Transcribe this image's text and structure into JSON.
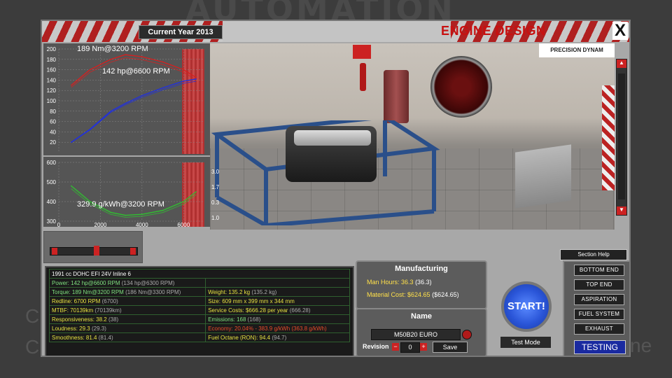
{
  "background": {
    "logo_text": "AUTOMATION",
    "left_letters": [
      "C",
      "C"
    ],
    "right_text": "ne"
  },
  "titlebar": {
    "year": "Current Year 2013",
    "title": "ENGINE DESIGN",
    "close": "X"
  },
  "viewport": {
    "dyno_brand": "PRECISION DYNAM"
  },
  "chart_data": [
    {
      "type": "line",
      "title": "",
      "y_ticks": [
        200,
        180,
        160,
        140,
        120,
        100,
        80,
        60,
        40,
        20
      ],
      "ylim": [
        0,
        200
      ],
      "annotations": [
        "189 Nm@3200 RPM",
        "142 hp@6600 RPM"
      ],
      "series": [
        {
          "color": "#d42020",
          "x": [
            600,
            1500,
            2500,
            3200,
            4000,
            5000,
            6000,
            6600
          ],
          "values": [
            130,
            160,
            180,
            189,
            185,
            175,
            160,
            145
          ]
        },
        {
          "color": "#2030e0",
          "x": [
            600,
            1500,
            2500,
            3200,
            4000,
            5000,
            6000,
            6600
          ],
          "values": [
            20,
            45,
            80,
            95,
            110,
            125,
            138,
            142
          ]
        }
      ]
    },
    {
      "type": "line",
      "title": "",
      "y_ticks": [
        600,
        500,
        400,
        300
      ],
      "x_ticks": [
        0,
        2000,
        4000,
        6000
      ],
      "ylim": [
        300,
        600
      ],
      "annotations": [
        "329.9 g/kWh@3200 RPM"
      ],
      "series": [
        {
          "color": "#30c030",
          "x": [
            600,
            1500,
            2500,
            3200,
            4000,
            5000,
            6000,
            6600
          ],
          "values": [
            480,
            400,
            345,
            330,
            335,
            355,
            400,
            450
          ]
        }
      ]
    }
  ],
  "right_axis_ticks": [
    "3.0",
    "1.7",
    "0.3",
    "1.0"
  ],
  "section_help": "Section Help",
  "stats": {
    "header": "1991 cc DOHC EFI 24V Inline 6",
    "rows": [
      {
        "left": "Power: 142 hp@6600 RPM",
        "left_paren": "(134 hp@6300 RPM)",
        "right": "",
        "right_paren": ""
      },
      {
        "left": "Torque: 189 Nm@3200 RPM",
        "left_paren": "(186 Nm@3300 RPM)",
        "right": "Weight: 135.2 kg",
        "right_paren": "(135.2 kg)"
      },
      {
        "left": "Redline: 6700 RPM",
        "left_paren": "(6700)",
        "right": "Size: 609 mm x 399 mm x 344 mm",
        "right_paren": ""
      },
      {
        "left": "MTBF: 70139km",
        "left_paren": "(70139km)",
        "right": "Service Costs: $666.28 per year",
        "right_paren": "(666.28)"
      },
      {
        "left": "Responsiveness: 38.2",
        "left_paren": "(38)",
        "right": "Emissions: 168",
        "right_paren": "(168)"
      },
      {
        "left": "Loudness: 29.3",
        "left_paren": "(29.3)",
        "right": "Economy: 20.04% - 383.9 g/kWh",
        "right_paren": "(363.8 g/kWh)"
      },
      {
        "left": "Smoothness: 81.4",
        "left_paren": "(81.4)",
        "right": "Fuel Octane (RON): 94.4",
        "right_paren": "(94.7)"
      }
    ]
  },
  "manufacturing": {
    "title": "Manufacturing",
    "man_hours": "Man Hours: 36.3",
    "man_hours_paren": "(36.3)",
    "material_cost": "Material Cost: $624.65",
    "material_cost_paren": "($624.65)"
  },
  "name_panel": {
    "title": "Name",
    "name_value": "M50B20 EURO",
    "revision_label": "Revision",
    "minus": "−",
    "revision_value": "0",
    "plus": "+",
    "save_label": "Save"
  },
  "start_label": "START!",
  "test_mode_label": "Test Mode",
  "nav": {
    "items": [
      "BOTTOM END",
      "TOP END",
      "ASPIRATION",
      "FUEL SYSTEM",
      "EXHAUST"
    ],
    "testing": "TESTING"
  }
}
